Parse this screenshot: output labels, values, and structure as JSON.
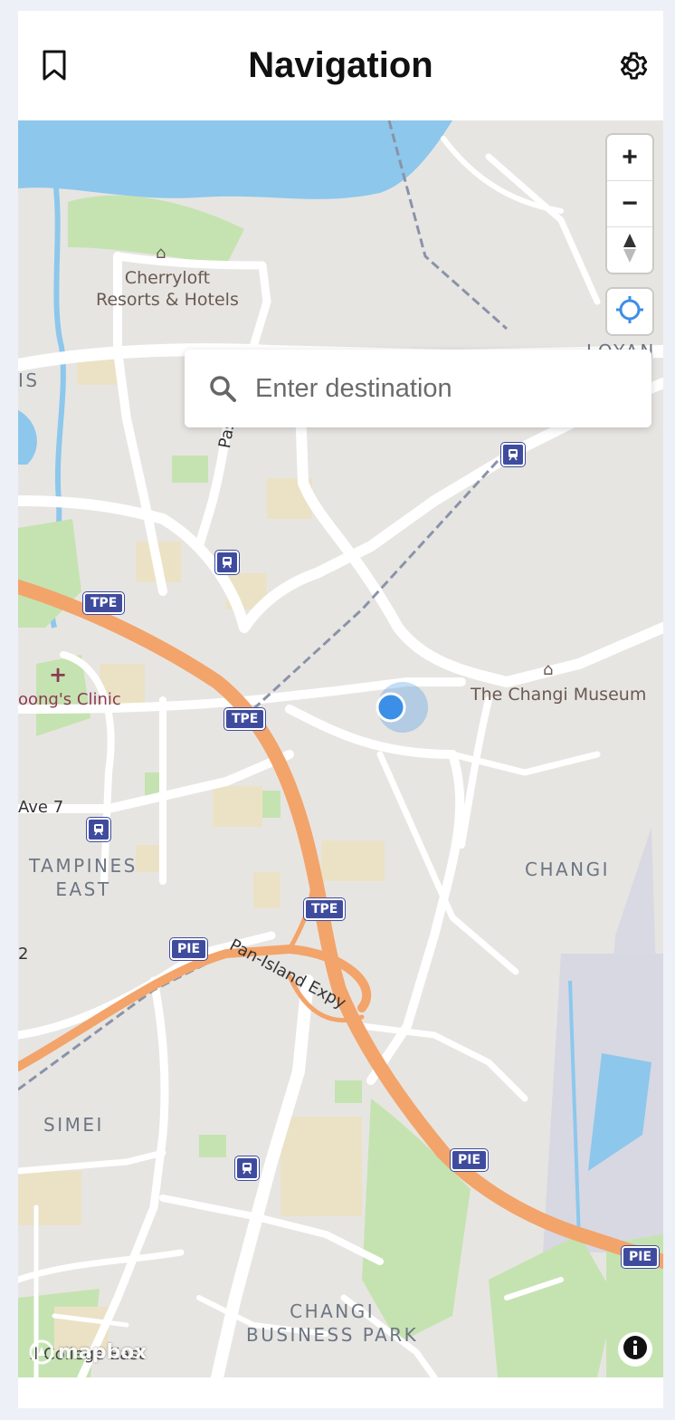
{
  "header": {
    "title": "Navigation",
    "bookmark_icon": "bookmark-icon",
    "settings_icon": "gear-icon"
  },
  "search": {
    "placeholder": "Enter destination",
    "icon": "search-icon"
  },
  "map_controls": {
    "zoom_in": "+",
    "zoom_out": "−",
    "compass_icon": "compass-icon",
    "locate_icon": "locate-icon",
    "info_icon": "info-icon"
  },
  "map": {
    "attribution_logo": "mapbox",
    "labels": {
      "hotel": [
        "Cherryloft",
        "Resorts & Hotels"
      ],
      "museum": "The Changi Museum",
      "clinic": "oong's Clinic",
      "tampines_east": [
        "TAMPINES",
        "EAST"
      ],
      "changi": "CHANGI",
      "simei": "SIMEI",
      "business_park": [
        "CHANGI",
        "BUSINESS PARK"
      ],
      "loyang": "LOYAN",
      "is": "IS",
      "pasir": "Pasir",
      "ave7": "Ave 7",
      "num2": "2",
      "expressway": "Pan-Island Expy",
      "college": "Il College East"
    },
    "shields": {
      "tpe1": "TPE",
      "tpe2": "TPE",
      "tpe3": "TPE",
      "pie1": "PIE",
      "pie2": "PIE",
      "pie3": "PIE"
    }
  },
  "colors": {
    "water": "#8dc7ec",
    "park": "#c5e3b1",
    "land": "#e7e5e2",
    "road": "#ffffff",
    "expressway": "#f3a46a",
    "shield": "#3f4c9e",
    "location_dot": "#3b8fe6"
  }
}
